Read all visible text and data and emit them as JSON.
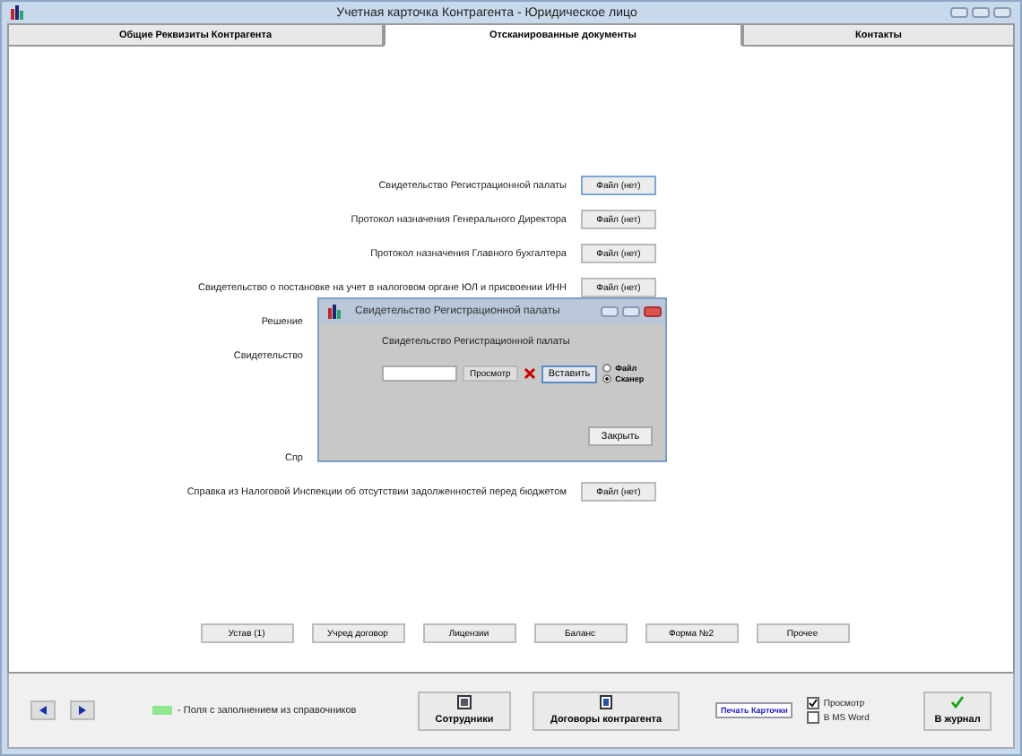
{
  "window": {
    "title": "Учетная карточка Контрагента - Юридическое лицо"
  },
  "tabs": [
    {
      "label": "Общие Реквизиты Контрагента",
      "selected": false
    },
    {
      "label": "Отсканированные документы",
      "selected": true
    },
    {
      "label": "Контакты",
      "selected": false
    }
  ],
  "documents_top": [
    {
      "label": "Свидетельство Регистрационной палаты",
      "button": "Файл (нет)",
      "focused": true,
      "covered": false
    },
    {
      "label": "Протокол назначения Генерального Директора",
      "button": "Файл (нет)",
      "focused": false,
      "covered": false
    },
    {
      "label": "Протокол назначения Главного бухгалтера",
      "button": "Файл (нет)",
      "focused": false,
      "covered": false
    },
    {
      "label": "Свидетельство о постановке на учет в налоговом органе ЮЛ и присвоении ИНН",
      "button": "Файл (нет)",
      "focused": false,
      "covered": false
    },
    {
      "label": "Решение",
      "covered": true
    },
    {
      "label": "Свидетельство",
      "covered": true
    }
  ],
  "documents_bottom": [
    {
      "label": "Спр",
      "covered": true
    },
    {
      "label": "Справка из Налоговой Инспекции об отсутствии задолженностей перед бюджетом",
      "button": "Файл (нет)",
      "focused": false,
      "covered": false
    }
  ],
  "category_buttons": [
    "Устав (1)",
    "Учред договор",
    "Лицензии",
    "Баланс",
    "Форма №2",
    "Прочее"
  ],
  "dialog": {
    "title": "Свидетельство Регистрационной палаты",
    "caption": "Свидетельство Регистрационной палаты",
    "view_button": "Просмотр",
    "insert_button": "Вставить",
    "sources": [
      {
        "label": "Файл",
        "selected": false
      },
      {
        "label": "Сканер",
        "selected": true
      }
    ],
    "close_button": "Закрыть"
  },
  "footer": {
    "legend": "- Поля с заполнением из справочников",
    "staff_button": "Сотрудники",
    "contracts_button": "Договоры контрагента",
    "print_button": "Печать Карточки",
    "options": [
      {
        "label": "Просмотр",
        "checked": true
      },
      {
        "label": "В MS Word",
        "checked": false
      }
    ],
    "journal_button": "В журнал"
  }
}
